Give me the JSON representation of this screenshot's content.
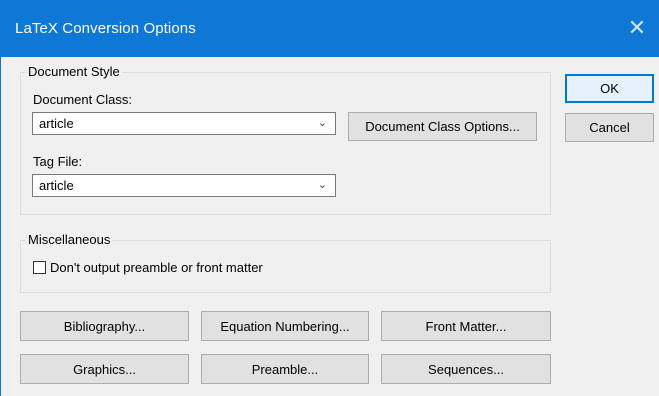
{
  "window": {
    "title": "LaTeX Conversion Options",
    "close_glyph": "✕"
  },
  "document_style": {
    "group_label": "Document Style",
    "document_class_label": "Document Class:",
    "document_class_value": "article",
    "document_class_options_button": "Document Class Options...",
    "tag_file_label": "Tag File:",
    "tag_file_value": "article"
  },
  "miscellaneous": {
    "group_label": "Miscellaneous",
    "preamble_checkbox_label": "Don't output preamble or front matter",
    "preamble_checked": false
  },
  "buttons": {
    "ok": "OK",
    "cancel": "Cancel",
    "bibliography": "Bibliography...",
    "equation_numbering": "Equation Numbering...",
    "front_matter": "Front Matter...",
    "graphics": "Graphics...",
    "preamble": "Preamble...",
    "sequences": "Sequences..."
  },
  "icons": {
    "close": "close-icon",
    "dropdown": "chevron-down-icon"
  },
  "colors": {
    "titlebar": "#0f78d6",
    "default_button_border": "#0078d7"
  }
}
